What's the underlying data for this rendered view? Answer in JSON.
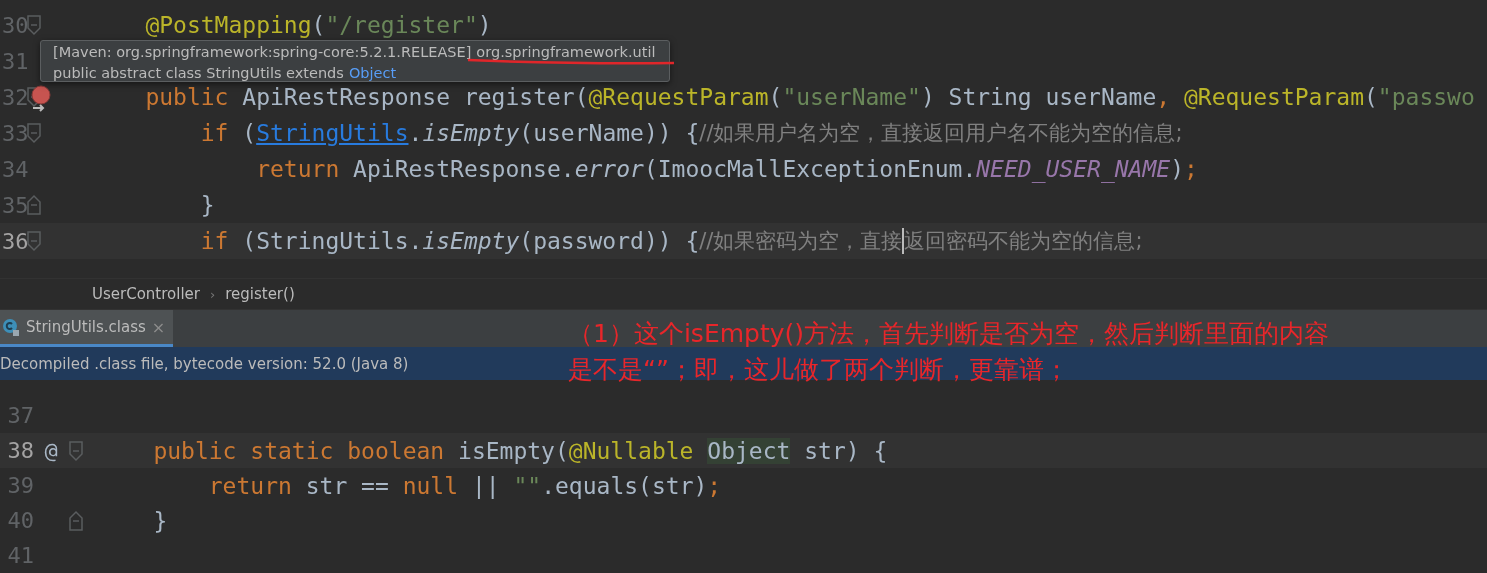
{
  "editor": {
    "lines": [
      {
        "number": "30",
        "fold_open": true,
        "tokens": [
          {
            "text": "    @PostMapping",
            "kind": "annotation"
          },
          {
            "text": "(",
            "kind": "plain"
          },
          {
            "text": "\"/register\"",
            "kind": "string"
          },
          {
            "text": ")",
            "kind": "plain"
          }
        ]
      },
      {
        "number": "31"
      },
      {
        "number": "32",
        "fold_open": true,
        "tokens": [
          {
            "text": "    public ",
            "kind": "keyword"
          },
          {
            "text": "ApiRestResponse ",
            "kind": "plain"
          },
          {
            "text": "register(",
            "kind": "plain"
          },
          {
            "text": "@RequestParam",
            "kind": "annotation"
          },
          {
            "text": "(",
            "kind": "plain"
          },
          {
            "text": "\"userName\"",
            "kind": "string"
          },
          {
            "text": ") String userName",
            "kind": "plain"
          },
          {
            "text": ", ",
            "kind": "keyword"
          },
          {
            "text": "@RequestParam",
            "kind": "annotation"
          },
          {
            "text": "(",
            "kind": "plain"
          },
          {
            "text": "\"passwo",
            "kind": "string"
          }
        ]
      },
      {
        "number": "33",
        "fold_open": true,
        "tokens": [
          {
            "text": "        if ",
            "kind": "keyword"
          },
          {
            "text": "(",
            "kind": "plain"
          },
          {
            "text": "StringUtils",
            "kind": "link"
          },
          {
            "text": ".",
            "kind": "plain"
          },
          {
            "text": "isEmpty",
            "kind": "method"
          },
          {
            "text": "(userName)) {",
            "kind": "plain"
          },
          {
            "text": "//如果用户名为空，直接返回用户名不能为空的信息;",
            "kind": "comment"
          }
        ]
      },
      {
        "number": "34",
        "tokens": [
          {
            "text": "            return ",
            "kind": "keyword"
          },
          {
            "text": "ApiRestResponse.",
            "kind": "plain"
          },
          {
            "text": "error",
            "kind": "method"
          },
          {
            "text": "(ImoocMallExceptionEnum.",
            "kind": "plain"
          },
          {
            "text": "NEED_USER_NAME",
            "kind": "constant"
          },
          {
            "text": ")",
            "kind": "plain"
          },
          {
            "text": ";",
            "kind": "keyword"
          }
        ]
      },
      {
        "number": "35",
        "fold_close": true,
        "tokens": [
          {
            "text": "        }",
            "kind": "plain"
          }
        ]
      },
      {
        "number": "36",
        "fold_open": true,
        "current": true,
        "tokens": [
          {
            "text": "        if ",
            "kind": "keyword"
          },
          {
            "text": "(StringUtils.",
            "kind": "plain"
          },
          {
            "text": "isEmpty",
            "kind": "method"
          },
          {
            "text": "(password)) {",
            "kind": "plain"
          },
          {
            "text": "//如果密码为空，直接",
            "kind": "comment"
          },
          {
            "text": "返回密码不能为空的信息;",
            "kind": "comment",
            "caret_before": true
          }
        ]
      }
    ]
  },
  "tooltip": {
    "source": "[Maven: org.springframework:spring-core:5.2.1.RELEASE]",
    "package": "org.springframework.util",
    "declaration": "public abstract class StringUtils extends",
    "link": "Object"
  },
  "breadcrumbs": [
    {
      "label": "UserController"
    },
    {
      "label": "register()",
      "separator": "›"
    }
  ],
  "tabs": [
    {
      "label": "StringUtils.class",
      "selected": true,
      "close": "×"
    }
  ],
  "banner": "Decompiled .class file, bytecode version: 52.0 (Java 8)",
  "decompiled": {
    "lines": [
      {
        "number": "37"
      },
      {
        "number": "38",
        "mark": "@",
        "fold_open": true,
        "current": true,
        "tokens": [
          {
            "text": "    public static boolean ",
            "kind": "keyword"
          },
          {
            "text": "isEmpty(",
            "kind": "plain"
          },
          {
            "text": "@Nullable ",
            "kind": "annotation"
          },
          {
            "text": "Object",
            "kind": "highlight"
          },
          {
            "text": " str) {",
            "kind": "plain"
          }
        ]
      },
      {
        "number": "39",
        "tokens": [
          {
            "text": "        return ",
            "kind": "keyword"
          },
          {
            "text": "str == ",
            "kind": "plain"
          },
          {
            "text": "null ",
            "kind": "keyword"
          },
          {
            "text": "|| ",
            "kind": "plain"
          },
          {
            "text": "\"\"",
            "kind": "string"
          },
          {
            "text": ".equals(str)",
            "kind": "plain"
          },
          {
            "text": ";",
            "kind": "keyword"
          }
        ]
      },
      {
        "number": "40",
        "fold_close": true,
        "tokens": [
          {
            "text": "    }",
            "kind": "plain"
          }
        ]
      },
      {
        "number": "41"
      }
    ]
  },
  "annotation": [
    "（1）这个isEmpty()方法，首先判断是否为空，然后判断里面的内容",
    "是不是“”；即，这儿做了两个判断，更靠谱；"
  ]
}
